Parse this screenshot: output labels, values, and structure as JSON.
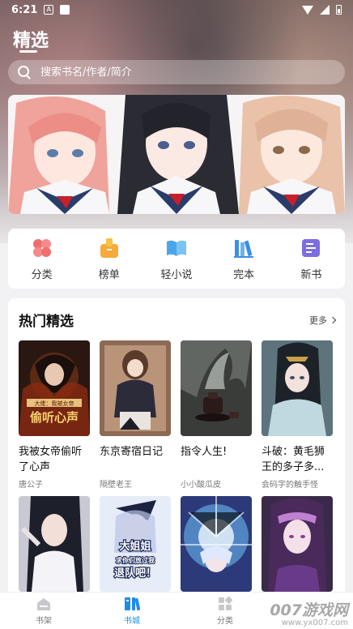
{
  "status_bar": {
    "time": "6:21"
  },
  "header": {
    "title": "精选"
  },
  "search": {
    "placeholder": "搜索书名/作者/简介"
  },
  "quick_nav": [
    {
      "label": "分类",
      "icon": "category-icon",
      "color": "#f26d6d"
    },
    {
      "label": "榜单",
      "icon": "ranking-icon",
      "color": "#f7a93a"
    },
    {
      "label": "轻小说",
      "icon": "light-novel-icon",
      "color": "#4aa6e8"
    },
    {
      "label": "完本",
      "icon": "completed-books-icon",
      "color": "#3b8fe8"
    },
    {
      "label": "新书",
      "icon": "new-book-icon",
      "color": "#7b6ee0"
    }
  ],
  "hot": {
    "title": "热门精选",
    "more": "更多",
    "books": [
      {
        "title": "我被女帝偷听了心声",
        "author": "唐公子"
      },
      {
        "title": "东京寄宿日记",
        "author": "隔壁老王"
      },
      {
        "title": "指令人生!",
        "author": "小小酸瓜皮"
      },
      {
        "title": "斗破：黄毛狮王的多子多...",
        "author": "会码字的触手怪"
      }
    ],
    "cover_texts": {
      "book1_sub": "大佬：我被女帝",
      "book1_main": "偷听心声",
      "book6_line1": "大姐姐",
      "book6_line2": "求你们放过我",
      "book6_line3": "退队吧！"
    }
  },
  "tabbar": [
    {
      "label": "书架",
      "active": false
    },
    {
      "label": "书城",
      "active": true
    },
    {
      "label": "分类",
      "active": false
    }
  ],
  "watermark": {
    "main": "007游戏网",
    "sub": "www.yx007.com"
  },
  "colors": {
    "accent": "#1d8de8"
  }
}
